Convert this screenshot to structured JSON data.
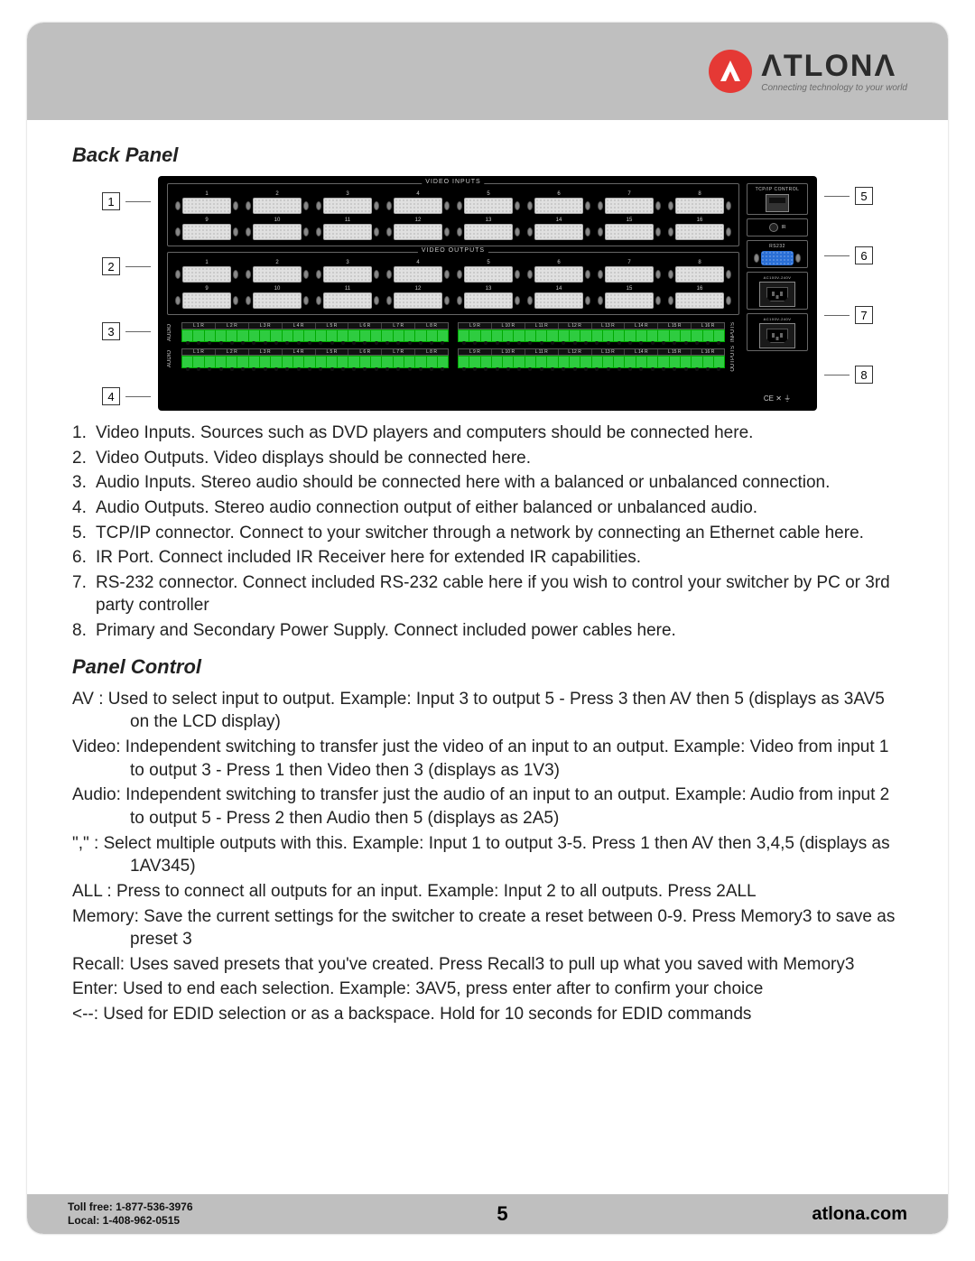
{
  "brand": {
    "name_rendered": "ΛTLONΛ",
    "tagline": "Connecting technology to your world"
  },
  "sections": {
    "back_panel": {
      "heading": "Back Panel",
      "diagram": {
        "video_inputs_label": "VIDEO INPUTS",
        "video_outputs_label": "VIDEO OUTPUTS",
        "port_numbers_top": [
          "1",
          "2",
          "3",
          "4",
          "5",
          "6",
          "7",
          "8"
        ],
        "port_numbers_bottom": [
          "9",
          "10",
          "11",
          "12",
          "13",
          "14",
          "15",
          "16"
        ],
        "tcpip_label": "TCP/IP CONTROL",
        "ir_label": "IR",
        "rs232_label": "RS232",
        "power_label": "AC100V-240V",
        "audio_side_inputs": "INPUTS",
        "audio_side_outputs": "OUTPUTS",
        "audio_side_audio": "AUDIO",
        "audio_labels_left": [
          "L 1 R",
          "L 2 R",
          "L 3 R",
          "L 4 R",
          "L 5 R",
          "L 6 R",
          "L 7 R",
          "L 8 R"
        ],
        "audio_labels_right": [
          "L 9 R",
          "L 10 R",
          "L 11 R",
          "L 12 R",
          "L 13 R",
          "L 14 R",
          "L 15 R",
          "L 16 R"
        ],
        "callouts_left": [
          "1",
          "2",
          "3",
          "4"
        ],
        "callouts_right": [
          "5",
          "6",
          "7",
          "8"
        ],
        "ce_marks": "CE ✕ ⏚"
      },
      "items": [
        {
          "n": "1.",
          "text": "Video Inputs. Sources such as DVD players and computers should be connected here."
        },
        {
          "n": "2.",
          "text": "Video Outputs. Video displays should be connected here."
        },
        {
          "n": "3.",
          "text": "Audio Inputs. Stereo audio should be connected here with a balanced or unbalanced connection."
        },
        {
          "n": "4.",
          "text": "Audio Outputs. Stereo audio connection output of either balanced or unbalanced audio."
        },
        {
          "n": "5.",
          "text": "TCP/IP connector. Connect to your switcher through a network by connecting an Ethernet cable here."
        },
        {
          "n": "6.",
          "text": "IR Port. Connect included IR Receiver here for extended IR capabilities."
        },
        {
          "n": "7.",
          "text": "RS-232 connector. Connect included RS-232 cable here if you wish to control your switcher by PC or 3rd party controller"
        },
        {
          "n": "8.",
          "text": "Primary and Secondary Power Supply. Connect included power cables here."
        }
      ]
    },
    "panel_control": {
      "heading": "Panel Control",
      "lines": [
        "AV : Used to select input to output. Example: Input 3 to output 5 - Press 3 then AV then 5 (displays as 3AV5 on the LCD display)",
        "Video: Independent switching to transfer just the video of an input to an output. Example: Video from input 1 to output 3 - Press 1 then Video then 3 (displays as 1V3)",
        "Audio: Independent switching to transfer just the audio of an input to an output. Example: Audio from input 2 to output 5 - Press 2 then Audio then 5 (displays as 2A5)",
        "\",\" : Select multiple outputs with this. Example: Input 1 to output 3-5. Press 1 then AV then 3,4,5 (displays as 1AV345)",
        "ALL : Press to connect all outputs for an input. Example: Input 2 to all outputs. Press 2ALL",
        "Memory: Save the current settings for the switcher to create a reset between 0-9. Press Memory3 to save as preset 3",
        "Recall: Uses saved presets that you've created. Press Recall3 to pull up what you saved with Memory3",
        "Enter: Used to end each selection. Example: 3AV5, press enter after to confirm your choice",
        "<--: Used for EDID selection or as a backspace. Hold for 10 seconds for EDID commands"
      ]
    }
  },
  "footer": {
    "tollfree": "Toll free: 1-877-536-3976",
    "local": "Local: 1-408-962-0515",
    "page": "5",
    "site": "atlona.com"
  }
}
